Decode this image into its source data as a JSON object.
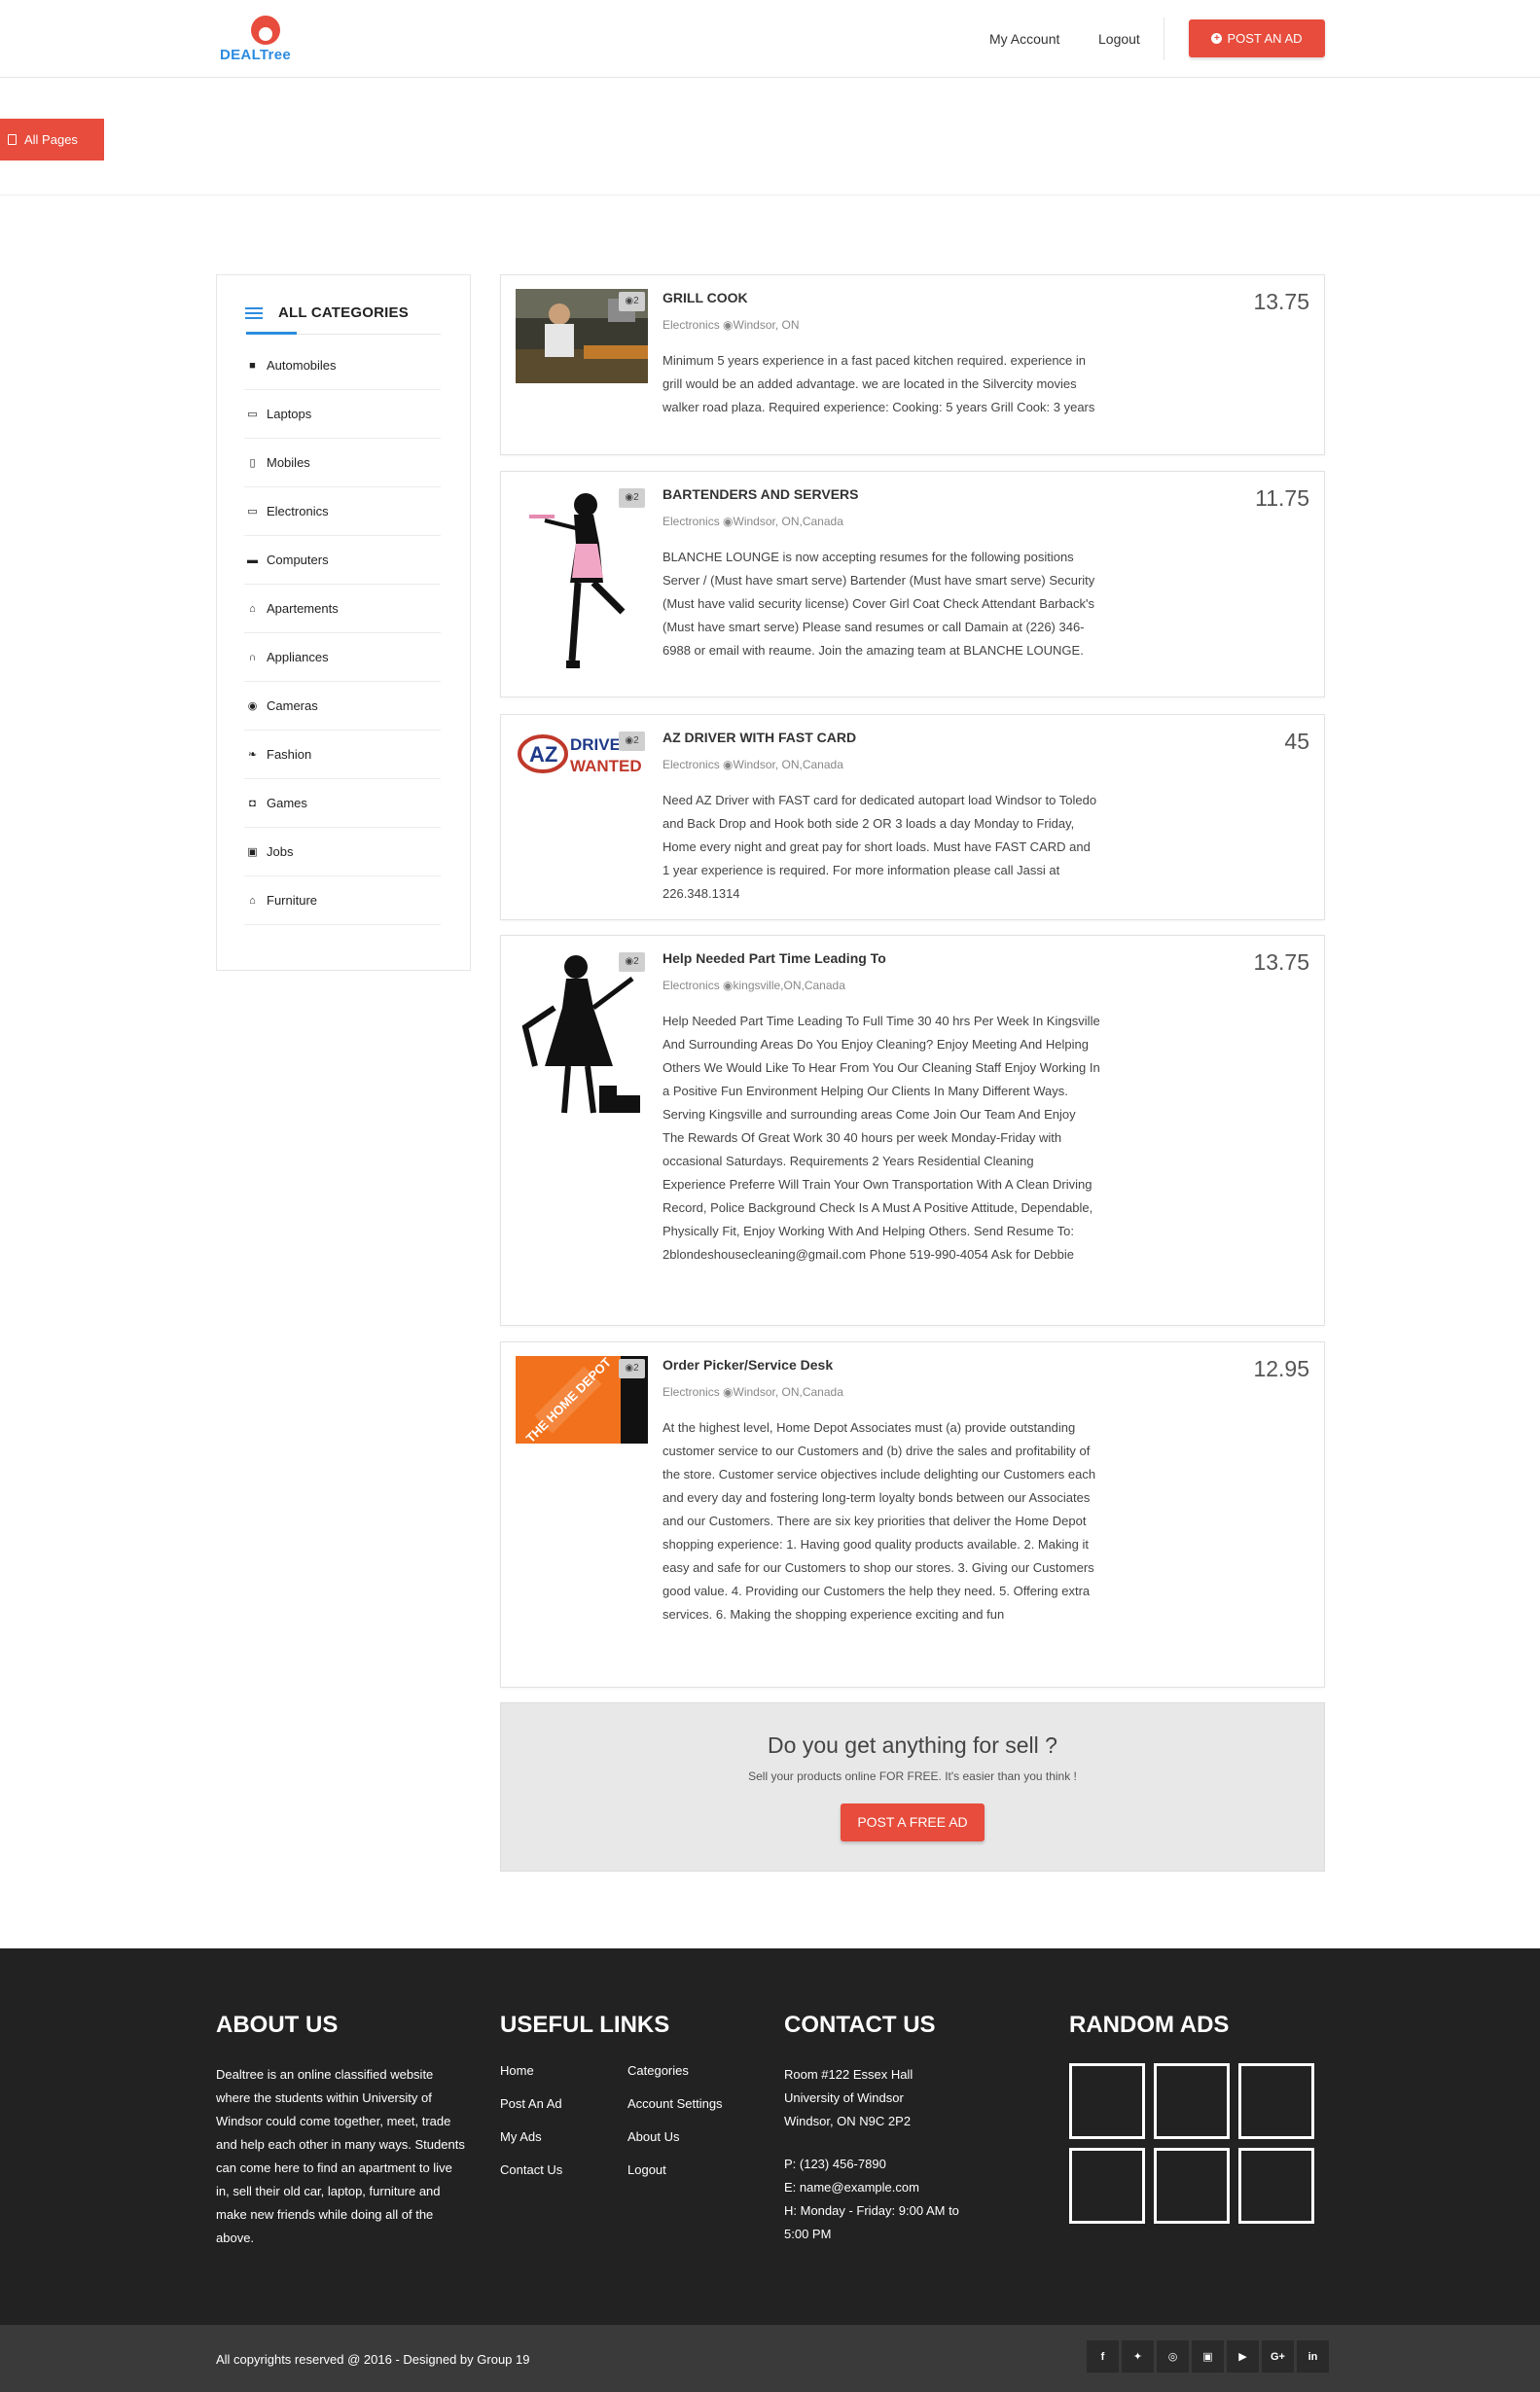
{
  "header": {
    "logo_text": "DEALTree",
    "nav": {
      "account": "My Account",
      "logout": "Logout"
    },
    "post_ad": "POST AN AD"
  },
  "all_pages": "All Pages",
  "sidebar": {
    "title": "ALL CATEGORIES",
    "items": [
      {
        "label": "Automobiles",
        "icon": "car-icon"
      },
      {
        "label": "Laptops",
        "icon": "laptop-icon"
      },
      {
        "label": "Mobiles",
        "icon": "mobile-icon"
      },
      {
        "label": "Electronics",
        "icon": "desktop-icon"
      },
      {
        "label": "Computers",
        "icon": "monitor-icon"
      },
      {
        "label": "Apartements",
        "icon": "home-icon"
      },
      {
        "label": "Appliances",
        "icon": "headphones-icon"
      },
      {
        "label": "Cameras",
        "icon": "camera-icon"
      },
      {
        "label": "Fashion",
        "icon": "leaf-icon"
      },
      {
        "label": "Games",
        "icon": "gamepad-icon"
      },
      {
        "label": "Jobs",
        "icon": "briefcase-icon"
      },
      {
        "label": "Furniture",
        "icon": "home-icon"
      }
    ]
  },
  "listings": [
    {
      "title": "GRILL COOK",
      "meta": "Electronics ◉Windsor, ON",
      "photo_count": "2",
      "price": "13.75",
      "description": "Minimum 5 years experience in a fast paced kitchen required. experience in grill would be an added advantage. we are located in the Silvercity movies walker road plaza. Required experience: Cooking: 5 years Grill Cook: 3 years"
    },
    {
      "title": "BARTENDERS AND SERVERS",
      "meta": "Electronics ◉Windsor, ON,Canada",
      "photo_count": "2",
      "price": "11.75",
      "description": "BLANCHE LOUNGE is now accepting resumes for the following positions Server / (Must have smart serve) Bartender (Must have smart serve) Security (Must have valid security license) Cover Girl Coat Check Attendant Barback's (Must have smart serve) Please sand resumes or call Damain at (226) 346-6988 or email with reaume. Join the amazing team at BLANCHE LOUNGE."
    },
    {
      "title": "AZ DRIVER WITH FAST CARD",
      "meta": "Electronics ◉Windsor, ON,Canada",
      "photo_count": "2",
      "price": "45",
      "description": "Need AZ Driver with FAST card for dedicated autopart load Windsor to Toledo and Back Drop and Hook both side 2 OR 3 loads a day Monday to Friday, Home every night and great pay for short loads. Must have FAST CARD and 1 year experience is required. For more information please call Jassi at 226.348.1314"
    },
    {
      "title": "Help Needed Part Time Leading To",
      "meta": "Electronics ◉kingsville,ON,Canada",
      "photo_count": "2",
      "price": "13.75",
      "description": "Help Needed Part Time Leading To Full Time 30 40 hrs Per Week In Kingsville And Surrounding Areas Do You Enjoy Cleaning? Enjoy Meeting And Helping Others We Would Like To Hear From You Our Cleaning Staff Enjoy Working In a Positive Fun Environment Helping Our Clients In Many Different Ways. Serving Kingsville and surrounding areas Come Join Our Team And Enjoy The Rewards Of Great Work 30 40 hours per week Monday-Friday with occasional Saturdays. Requirements 2 Years Residential Cleaning Experience Preferre Will Train Your Own Transportation With A Clean Driving Record, Police Background Check Is A Must A Positive Attitude, Dependable, Physically Fit, Enjoy Working With And Helping Others. Send Resume To: 2blondeshousecleaning@gmail.com Phone 519-990-4054 Ask for Debbie"
    },
    {
      "title": "Order Picker/Service Desk",
      "meta": "Electronics ◉Windsor, ON,Canada",
      "photo_count": "2",
      "price": "12.95",
      "description": "At the highest level, Home Depot Associates must (a) provide outstanding customer service to our Customers and (b) drive the sales and profitability of the store. Customer service objectives include delighting our Customers each and every day and fostering long-term loyalty bonds between our Associates and our Customers. There are six key priorities that deliver the Home Depot shopping experience: 1. Having good quality products available. 2. Making it easy and safe for our Customers to shop our stores. 3. Giving our Customers good value. 4. Providing our Customers the help they need. 5. Offering extra services. 6. Making the shopping experience exciting and fun"
    }
  ],
  "thumb_text": {
    "az_top": "DRIVE",
    "az_bottom": "WANTED",
    "az_letters": "AZ",
    "home_depot": "THE HOME DEPOT"
  },
  "cta": {
    "title": "Do you get anything for sell ?",
    "subtitle": "Sell your products online FOR FREE. It's easier than you think !",
    "button": "POST A FREE AD"
  },
  "footer": {
    "about_title": "ABOUT US",
    "about_text": "Dealtree is an online classified website where the students within University of Windsor could come together, meet, trade and help each other in many ways. Students can come here to find an apartment to live in, sell their old car, laptop, furniture and make new friends while doing all of the above.",
    "links_title": "USEFUL LINKS",
    "links_left": [
      "Home",
      "Post An Ad",
      "My Ads",
      "Contact Us"
    ],
    "links_right": [
      "Categories",
      "Account Settings",
      "About Us",
      "Logout"
    ],
    "contact_title": "CONTACT US",
    "address": [
      "Room #122 Essex Hall",
      "University of Windsor",
      "Windsor, ON N9C 2P2"
    ],
    "phone": "P: (123) 456-7890",
    "email": "E: name@example.com",
    "hours": [
      "H: Monday - Friday: 9:00 AM to",
      "5:00 PM"
    ],
    "random_title": "RANDOM ADS",
    "copyright": "All copyrights reserved @ 2016 - Designed by Group 19",
    "socials": [
      {
        "glyph": "f",
        "icon": "facebook-icon"
      },
      {
        "glyph": "✦",
        "icon": "twitter-icon"
      },
      {
        "glyph": "◎",
        "icon": "dribbble-icon"
      },
      {
        "glyph": "▣",
        "icon": "flickr-icon"
      },
      {
        "glyph": "▶",
        "icon": "youtube-icon"
      },
      {
        "glyph": "G+",
        "icon": "google-plus-icon"
      },
      {
        "glyph": "in",
        "icon": "linkedin-icon"
      }
    ]
  },
  "colors": {
    "accent": "#e74c3c",
    "brand_blue": "#2c8be0",
    "footer_bg": "#222222",
    "bottom_bar_bg": "#3a3a3a"
  }
}
